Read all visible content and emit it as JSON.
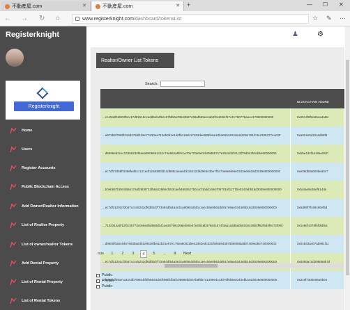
{
  "browser": {
    "tabs": [
      {
        "title": "不動産屋.com"
      },
      {
        "title": "不動産屋.com"
      }
    ],
    "url_host": "www.registerknight.com",
    "url_path": "/dashboard/tokensList"
  },
  "sidebar": {
    "brand": "Registerknight",
    "card_button": "Registerknight",
    "items": [
      {
        "label": "Home"
      },
      {
        "label": "Users"
      },
      {
        "label": "Register Accounts"
      },
      {
        "label": "Public Blockchain Access"
      },
      {
        "label": "Add Owner/Realtor Information"
      },
      {
        "label": "List of Realtor Property"
      },
      {
        "label": "List of owner/realtor Tokens"
      },
      {
        "label": "Add Rental Property"
      },
      {
        "label": "List of Rental Property"
      },
      {
        "label": "List of Rental Tokens"
      }
    ]
  },
  "main": {
    "title": "Realtor/Owner List Tokens",
    "search_label": "Search:",
    "column_header": "BLOCKCHAIN ADDRE",
    "rows": [
      {
        "hash": "...cc42a2f18b03f5cc17d91518ccedd5eb4f6cc57fdb0a78542b87438af692eecab2f14d004f17c4175077baee4179900000000",
        "addr": "0x2514f9f3e654a4a58",
        "color": "#dceab8"
      },
      {
        "hash": "...a972b6f758bf315d376bf1b5c77630ea713eb0d1e1d0fbc18eb17453dee588fe6e10b3e00c2918a4d1054781fc3e2335377e4c00",
        "addr": "0xa024e5d22c6db8f6",
        "color": "#cfe7f3"
      },
      {
        "hash": "...d5695ed2cec22358235f6aea9808661cb2c74e662a6f5cce70e703e5e0cb05865727e252dd2f3413f79d047b6cbbe60000000",
        "addr": "0xbbe1d4f1a18ae0b2f",
        "color": "#dceab8"
      },
      {
        "hash": "...ec7df37d58ff4388fed61c121edf12a838bfd14d595caeaedcb15412d4d9e5e3be7fbc74e8e5fe6e0343eebb16d3039e800000000",
        "addr": "0xe09db8a600bed047",
        "color": "#cfe7f3"
      },
      {
        "hash": "...b0eb847b08c6b5617a5f26b8721fb6a226664f1b3caeb4692627b0c4cf1bdd14667097016f1277be0343ebb16d3039e800000000",
        "addr": "0xfa4ae8e35ef814da",
        "color": "#dceab8"
      },
      {
        "hash": "...ec7df31202cf2b67cc445232df0dbbd7f73484dfa4a3e31a90563af4bc1eec56e0b62dd917e8ae0343ebb16d3039e800000000",
        "addr": "0x6d99f7f449c80ef6d",
        "color": "#cfe7f3"
      },
      {
        "hash": "...7133314a0f11f0c35773c0e8edbd868db41ae25799c266e080e37e4fdcab376841674f3aa1a3d6a0b8192438b0ff62f5d4f9c72f000",
        "addr": "0x149ef1078f6f0bbba",
        "color": "#dceab8"
      },
      {
        "hash": "...d8600f0a649497e83bad4b1e9536fbea2b21e97e175ea8c811be42362edc321f6066943875b6008da8b7409ed8e740000000",
        "addr": "0x04833a407ab991f1c",
        "color": "#cfe7f3"
      },
      {
        "hash": "...ec7df31202cf2b67cc445232df0dbbd7f73484dfa4a3e31a90563af4bc1eec56e0b62dd917e8ae0343ebb16d3039e800000000",
        "addr": "0x8390a7dd299059b7d",
        "color": "#dceab8"
      },
      {
        "hash": "...fe557df49a7ca10cdb7880cbf4f58834d20f398f1fb5f10999ebde37b8f5b721299e4cc3076f5b8e0343ebb16d3039e800000000",
        "addr": "0x2c8f730be8560be0",
        "color": "#cfe7f3"
      }
    ],
    "pagination": [
      "ous",
      "1",
      "2",
      "3",
      "4",
      "5",
      "...",
      "8",
      "Next"
    ],
    "current_page": "4",
    "checkboxes": [
      "Public",
      "Private",
      "Public"
    ]
  }
}
